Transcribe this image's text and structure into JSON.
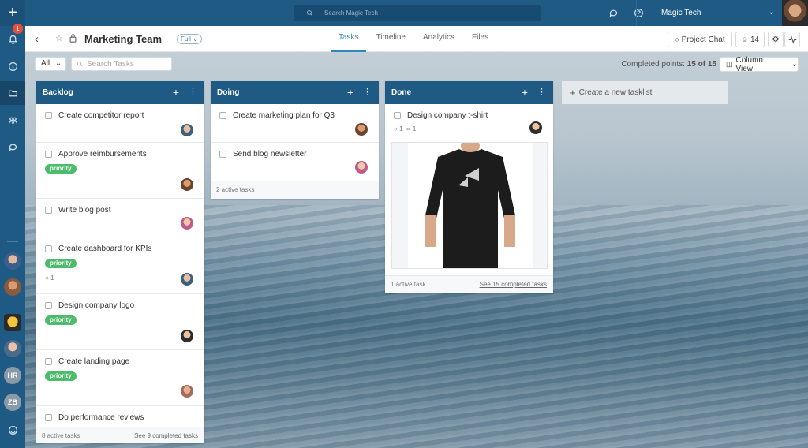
{
  "rail": {
    "add_label": "+",
    "notif_count": "1",
    "avatars": [
      {
        "initials": "HR"
      },
      {
        "initials": "ZB"
      }
    ]
  },
  "topbar": {
    "search_placeholder": "Search Magic Tech",
    "company": "Magic Tech"
  },
  "header": {
    "title": "Marketing Team",
    "visibility": "Full",
    "tabs": [
      {
        "label": "Tasks"
      },
      {
        "label": "Timeline"
      },
      {
        "label": "Analytics"
      },
      {
        "label": "Files"
      }
    ],
    "project_chat": "Project Chat",
    "member_count": "14"
  },
  "filters": {
    "filter_value": "All",
    "search_placeholder": "Search Tasks",
    "completed_label": "Completed points:",
    "completed_value": "15 of 15",
    "view_label": "Column View"
  },
  "columns": [
    {
      "title": "Backlog",
      "cards": [
        {
          "title": "Create competitor report"
        },
        {
          "title": "Approve reimbursements",
          "tag": "priority"
        },
        {
          "title": "Write blog post"
        },
        {
          "title": "Create dashboard for KPIs",
          "tag": "priority",
          "comments": "1"
        },
        {
          "title": "Design company logo",
          "tag": "priority"
        },
        {
          "title": "Create landing page",
          "tag": "priority"
        },
        {
          "title": "Do performance reviews"
        }
      ],
      "footer_left": "8 active tasks",
      "footer_right": "See 9 completed tasks"
    },
    {
      "title": "Doing",
      "cards": [
        {
          "title": "Create marketing plan for Q3"
        },
        {
          "title": "Send blog newsletter"
        }
      ],
      "footer_left": "2 active tasks"
    },
    {
      "title": "Done",
      "cards": [
        {
          "title": "Design company t-shirt",
          "comments": "1",
          "attachments": "1"
        }
      ],
      "footer_left": "1 active task",
      "footer_right": "See 15 completed tasks"
    }
  ],
  "new_tasklist": "Create a new tasklist",
  "colors": {
    "navy": "#1f5a85",
    "priority": "#4cbb6c",
    "accent": "#2e88b8"
  }
}
